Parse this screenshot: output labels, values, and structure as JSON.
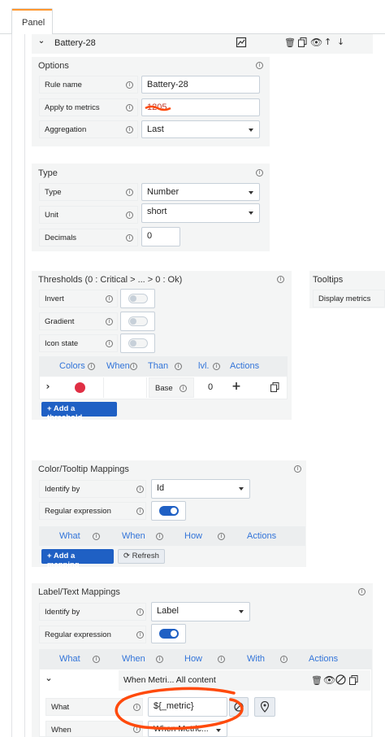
{
  "tabs": {
    "panel": "Panel"
  },
  "rule": {
    "name_header": "Battery-28"
  },
  "options": {
    "title": "Options",
    "rule_name_label": "Rule name",
    "rule_name_value": "Battery-28",
    "apply_label": "Apply to metrics",
    "apply_value": "1205",
    "aggregation_label": "Aggregation",
    "aggregation_value": "Last"
  },
  "type_section": {
    "title": "Type",
    "type_label": "Type",
    "type_value": "Number",
    "unit_label": "Unit",
    "unit_value": "short",
    "decimals_label": "Decimals",
    "decimals_value": "0"
  },
  "thresholds": {
    "title": "Thresholds (0 : Critical > ... > 0 : Ok)",
    "invert_label": "Invert",
    "gradient_label": "Gradient",
    "icon_state_label": "Icon state",
    "columns": {
      "colors": "Colors",
      "when": "When",
      "than": "Than",
      "lvl": "lvl.",
      "actions": "Actions"
    },
    "row": {
      "than": "Base",
      "lvl": "0",
      "color": "#e02f44"
    },
    "add_button": "Add a threshold"
  },
  "tooltips": {
    "title": "Tooltips",
    "display_metrics": "Display metrics"
  },
  "color_mappings": {
    "title": "Color/Tooltip Mappings",
    "identify_label": "Identify by",
    "identify_value": "Id",
    "regex_label": "Regular expression",
    "columns": {
      "what": "What",
      "when": "When",
      "how": "How",
      "actions": "Actions"
    },
    "add_button": "Add a mapping",
    "refresh_button": "Refresh"
  },
  "label_mappings": {
    "title": "Label/Text Mappings",
    "identify_label": "Identify by",
    "identify_value": "Label",
    "regex_label": "Regular expression",
    "columns": {
      "what": "What",
      "when": "When",
      "how": "How",
      "with": "With",
      "actions": "Actions"
    },
    "row_summary": "When Metri... All content",
    "what_label": "What",
    "what_value": "${_metric}",
    "when_label": "When",
    "when_value": "When Metric..."
  },
  "colors": {
    "accent": "#1f60c4",
    "link": "#3274d9",
    "tab_accent": "#ff9830",
    "annotation": "#ff4a0c"
  }
}
